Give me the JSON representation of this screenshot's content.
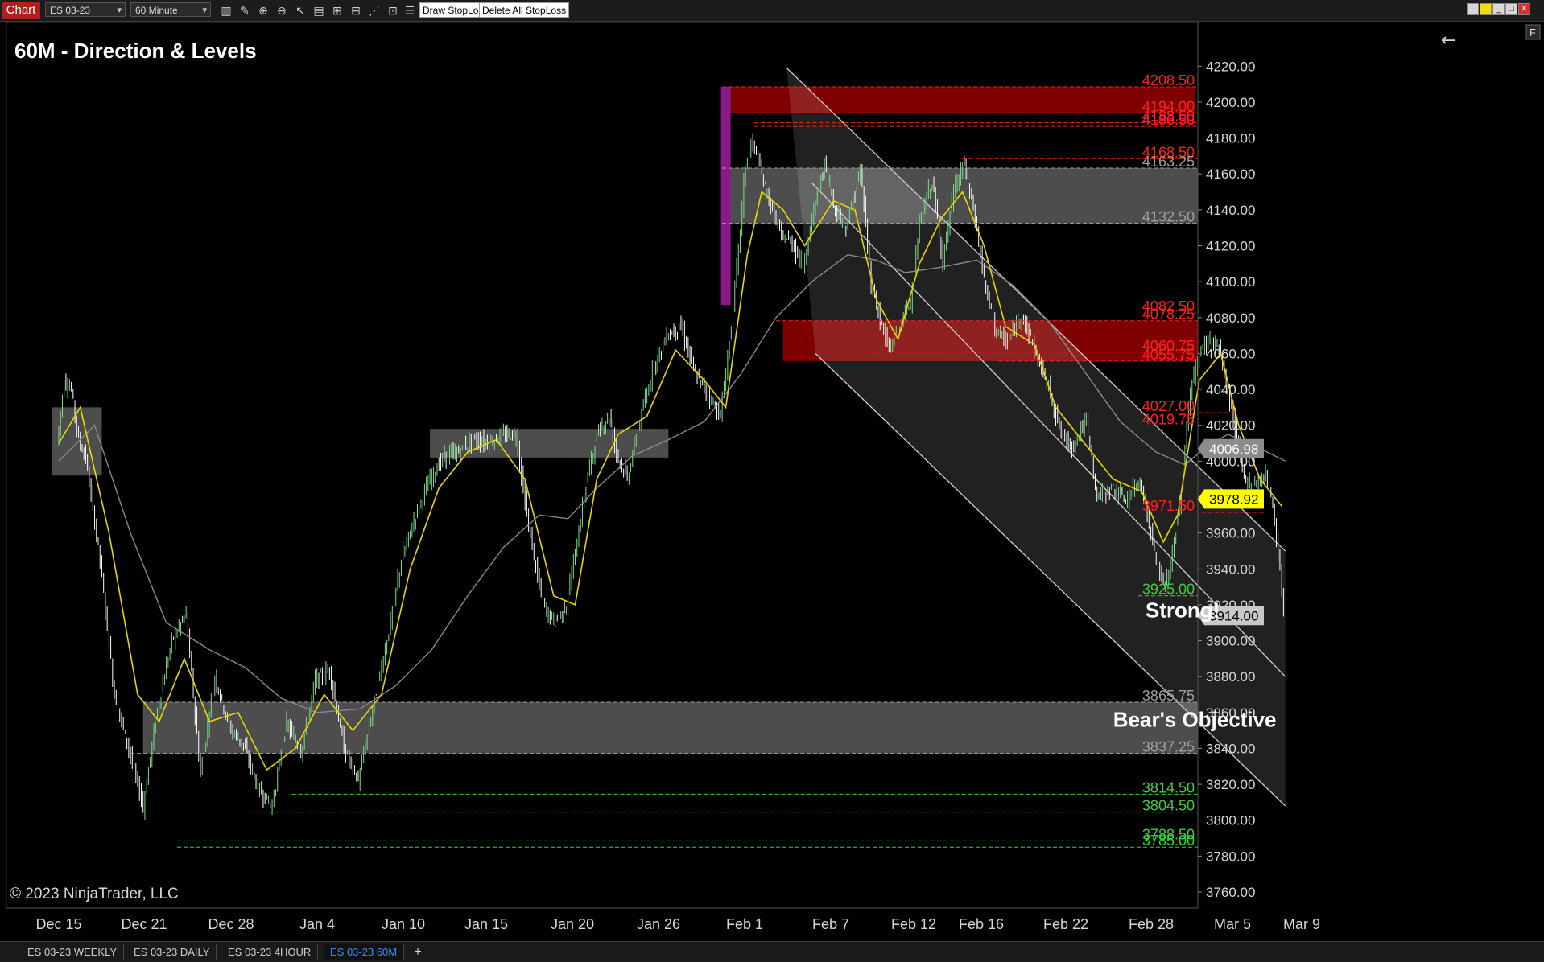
{
  "toolbar": {
    "chart_label": "Chart",
    "instrument": "ES 03-23",
    "interval": "60 Minute",
    "draw_stoploss": "Draw StopLoss",
    "delete_stoploss": "Delete All StopLoss"
  },
  "tabs": [
    {
      "label": "ES 03-23 WEEKLY",
      "active": false
    },
    {
      "label": "ES 03-23 DAILY",
      "active": false
    },
    {
      "label": "ES 03-23 4HOUR",
      "active": false
    },
    {
      "label": "ES 03-23 60M",
      "active": true
    }
  ],
  "tab_add": "+",
  "f_label": "F",
  "chart_data": {
    "type": "candlestick",
    "title": "60M - Direction & Levels",
    "copyright": "© 2023 NinjaTrader, LLC",
    "ylim": [
      3760,
      4230
    ],
    "y_ticks": [
      "4220.00",
      "4200.00",
      "4180.00",
      "4160.00",
      "4140.00",
      "4120.00",
      "4100.00",
      "4080.00",
      "4060.00",
      "4040.00",
      "4020.00",
      "4000.00",
      "3980.00",
      "3960.00",
      "3940.00",
      "3920.00",
      "3900.00",
      "3880.00",
      "3860.00",
      "3840.00",
      "3820.00",
      "3800.00",
      "3780.00",
      "3760.00"
    ],
    "x_ticks": [
      "Dec 15",
      "Dec 21",
      "Dec 28",
      "Jan 4",
      "Jan 10",
      "Jan 15",
      "Jan 20",
      "Jan 26",
      "Feb 1",
      "Feb 7",
      "Feb 12",
      "Feb 16",
      "Feb 22",
      "Feb 28",
      "Mar 5",
      "Mar 9"
    ],
    "price_series": [
      [
        0,
        4010
      ],
      [
        0.2,
        4045
      ],
      [
        0.4,
        4040
      ],
      [
        0.6,
        4012
      ],
      [
        0.8,
        4002
      ],
      [
        1.2,
        3945
      ],
      [
        1.6,
        3870
      ],
      [
        2.0,
        3840
      ],
      [
        2.4,
        3808
      ],
      [
        2.8,
        3862
      ],
      [
        3.2,
        3900
      ],
      [
        3.6,
        3915
      ],
      [
        4.0,
        3825
      ],
      [
        4.4,
        3880
      ],
      [
        4.8,
        3852
      ],
      [
        5.2,
        3842
      ],
      [
        5.6,
        3818
      ],
      [
        6.0,
        3808
      ],
      [
        6.4,
        3854
      ],
      [
        6.8,
        3838
      ],
      [
        7.2,
        3878
      ],
      [
        7.6,
        3884
      ],
      [
        8.0,
        3840
      ],
      [
        8.4,
        3822
      ],
      [
        8.8,
        3862
      ],
      [
        9.2,
        3900
      ],
      [
        9.6,
        3945
      ],
      [
        10.0,
        3970
      ],
      [
        10.4,
        3990
      ],
      [
        10.8,
        4003
      ],
      [
        11.2,
        4005
      ],
      [
        11.6,
        4012
      ],
      [
        12.0,
        4010
      ],
      [
        12.4,
        4014
      ],
      [
        12.8,
        4015
      ],
      [
        13.1,
        3970
      ],
      [
        13.4,
        3935
      ],
      [
        13.6,
        3918
      ],
      [
        13.9,
        3910
      ],
      [
        14.2,
        3920
      ],
      [
        14.5,
        3955
      ],
      [
        14.8,
        3993
      ],
      [
        15.1,
        4017
      ],
      [
        15.4,
        4025
      ],
      [
        15.6,
        4005
      ],
      [
        15.9,
        3990
      ],
      [
        16.2,
        4018
      ],
      [
        16.6,
        4050
      ],
      [
        17.0,
        4070
      ],
      [
        17.4,
        4075
      ],
      [
        17.8,
        4048
      ],
      [
        18.2,
        4036
      ],
      [
        18.5,
        4025
      ],
      [
        18.8,
        4075
      ],
      [
        19.0,
        4118
      ],
      [
        19.2,
        4165
      ],
      [
        19.4,
        4178
      ],
      [
        19.6,
        4163
      ],
      [
        19.9,
        4142
      ],
      [
        20.2,
        4125
      ],
      [
        20.5,
        4122
      ],
      [
        20.8,
        4108
      ],
      [
        21.1,
        4140
      ],
      [
        21.4,
        4166
      ],
      [
        21.7,
        4140
      ],
      [
        22.0,
        4130
      ],
      [
        22.4,
        4162
      ],
      [
        22.7,
        4100
      ],
      [
        23.0,
        4075
      ],
      [
        23.2,
        4062
      ],
      [
        23.5,
        4075
      ],
      [
        23.8,
        4090
      ],
      [
        24.1,
        4138
      ],
      [
        24.4,
        4156
      ],
      [
        24.7,
        4112
      ],
      [
        25.0,
        4150
      ],
      [
        25.3,
        4166
      ],
      [
        25.6,
        4135
      ],
      [
        25.9,
        4095
      ],
      [
        26.2,
        4072
      ],
      [
        26.5,
        4066
      ],
      [
        26.9,
        4082
      ],
      [
        27.3,
        4060
      ],
      [
        27.7,
        4038
      ],
      [
        28.0,
        4015
      ],
      [
        28.3,
        4008
      ],
      [
        28.7,
        4023
      ],
      [
        29.0,
        3980
      ],
      [
        29.4,
        3985
      ],
      [
        29.8,
        3978
      ],
      [
        30.2,
        3990
      ],
      [
        30.5,
        3960
      ],
      [
        30.8,
        3932
      ],
      [
        31.0,
        3936
      ],
      [
        31.3,
        3975
      ],
      [
        31.6,
        4040
      ],
      [
        31.9,
        4062
      ],
      [
        32.1,
        4068
      ],
      [
        32.4,
        4063
      ],
      [
        32.6,
        4044
      ],
      [
        32.8,
        4023
      ],
      [
        33.1,
        3990
      ],
      [
        33.4,
        3987
      ],
      [
        33.7,
        3993
      ],
      [
        33.9,
        3976
      ],
      [
        34.1,
        3940
      ],
      [
        34.2,
        3915
      ]
    ],
    "ema_fast": [
      [
        0,
        4010
      ],
      [
        0.6,
        4030
      ],
      [
        1.4,
        3960
      ],
      [
        2.2,
        3870
      ],
      [
        2.8,
        3855
      ],
      [
        3.5,
        3890
      ],
      [
        4.2,
        3855
      ],
      [
        5.0,
        3860
      ],
      [
        5.8,
        3828
      ],
      [
        6.6,
        3840
      ],
      [
        7.4,
        3870
      ],
      [
        8.2,
        3850
      ],
      [
        9.0,
        3870
      ],
      [
        9.8,
        3940
      ],
      [
        10.6,
        3985
      ],
      [
        11.4,
        4005
      ],
      [
        12.2,
        4012
      ],
      [
        13.0,
        3990
      ],
      [
        13.8,
        3925
      ],
      [
        14.4,
        3920
      ],
      [
        15.0,
        3990
      ],
      [
        15.6,
        4015
      ],
      [
        16.4,
        4025
      ],
      [
        17.2,
        4062
      ],
      [
        18.0,
        4045
      ],
      [
        18.6,
        4030
      ],
      [
        19.2,
        4115
      ],
      [
        19.6,
        4150
      ],
      [
        20.2,
        4140
      ],
      [
        20.8,
        4120
      ],
      [
        21.6,
        4145
      ],
      [
        22.2,
        4140
      ],
      [
        22.8,
        4090
      ],
      [
        23.4,
        4068
      ],
      [
        24.0,
        4110
      ],
      [
        24.6,
        4135
      ],
      [
        25.2,
        4150
      ],
      [
        25.8,
        4120
      ],
      [
        26.4,
        4075
      ],
      [
        27.2,
        4065
      ],
      [
        27.8,
        4030
      ],
      [
        28.6,
        4010
      ],
      [
        29.4,
        3990
      ],
      [
        30.2,
        3983
      ],
      [
        30.8,
        3955
      ],
      [
        31.2,
        3970
      ],
      [
        31.8,
        4045
      ],
      [
        32.4,
        4060
      ],
      [
        32.9,
        4020
      ],
      [
        33.5,
        3990
      ],
      [
        34.1,
        3975
      ]
    ],
    "sma_slow": [
      [
        0,
        4000
      ],
      [
        1.0,
        4020
      ],
      [
        2.0,
        3960
      ],
      [
        3.0,
        3910
      ],
      [
        4.2,
        3895
      ],
      [
        5.2,
        3885
      ],
      [
        6.2,
        3868
      ],
      [
        7.2,
        3860
      ],
      [
        8.4,
        3862
      ],
      [
        9.4,
        3875
      ],
      [
        10.4,
        3895
      ],
      [
        11.4,
        3925
      ],
      [
        12.4,
        3952
      ],
      [
        13.4,
        3970
      ],
      [
        14.2,
        3968
      ],
      [
        15.0,
        3985
      ],
      [
        16.0,
        4003
      ],
      [
        17.0,
        4012
      ],
      [
        18.0,
        4022
      ],
      [
        19.0,
        4048
      ],
      [
        20.0,
        4080
      ],
      [
        21.0,
        4100
      ],
      [
        22.0,
        4115
      ],
      [
        22.8,
        4112
      ],
      [
        23.6,
        4105
      ],
      [
        24.6,
        4108
      ],
      [
        25.6,
        4112
      ],
      [
        26.6,
        4098
      ],
      [
        27.6,
        4078
      ],
      [
        28.6,
        4050
      ],
      [
        29.6,
        4022
      ],
      [
        30.6,
        4005
      ],
      [
        31.4,
        3998
      ],
      [
        32.0,
        4008
      ],
      [
        32.6,
        4015
      ],
      [
        33.4,
        4008
      ],
      [
        34.2,
        4000
      ]
    ],
    "gray_zones": [
      {
        "y_high": 4163.25,
        "y_low": 4132.5,
        "x_from": 18.5,
        "x_to": 34.2
      },
      {
        "y_high": 4018.0,
        "y_low": 4002.0,
        "x_from": 10.35,
        "x_to": 17.0
      },
      {
        "y_high": 4030.0,
        "y_low": 3992.0,
        "x_from": -0.2,
        "x_to": 1.2
      },
      {
        "y_high": 3865.75,
        "y_low": 3837.25,
        "x_from": 2.35,
        "x_to": 34.2
      }
    ],
    "red_zones": [
      {
        "y_high": 4208.5,
        "y_low": 4194.0,
        "x_from": 18.7,
        "x_to": 31.7
      },
      {
        "y_high": 4078.25,
        "y_low": 4055.75,
        "x_from": 20.2,
        "x_to": 34.2
      }
    ],
    "purple_bar": {
      "x": 18.6,
      "y_high": 4208.5,
      "y_low": 4087
    },
    "channel": {
      "upper": [
        [
          20.3,
          4219
        ],
        [
          34.2,
          3950
        ]
      ],
      "middle": [
        [
          21.0,
          4155
        ],
        [
          34.2,
          3880
        ]
      ],
      "lower": [
        [
          21.1,
          4060
        ],
        [
          34.2,
          3808
        ]
      ]
    },
    "levels": [
      {
        "label": "4208.50",
        "value": 4208.5,
        "color": "#ff2020",
        "x_from": 18.5
      },
      {
        "label": "4194.00",
        "value": 4194.0,
        "color": "#ff2020",
        "x_from": 18.6
      },
      {
        "label": "4188.50",
        "value": 4188.5,
        "color": "#ff2020",
        "x_from": 19.4
      },
      {
        "label": "4186.50",
        "value": 4186.5,
        "color": "#ff2020",
        "x_from": 19.4
      },
      {
        "label": "4168.50",
        "value": 4168.5,
        "color": "#ff2020",
        "x_from": 25.2
      },
      {
        "label": "4163.25",
        "value": 4163.25,
        "color": "#a0a0a0",
        "x_from": 18.5
      },
      {
        "label": "4132.50",
        "value": 4132.5,
        "color": "#a0a0a0",
        "x_from": 18.5
      },
      {
        "label": "4082.50",
        "value": 4082.5,
        "color": "#ff2020",
        "x_from": 31.6
      },
      {
        "label": "4078.25",
        "value": 4078.25,
        "color": "#ff2020",
        "x_from": 20.0
      },
      {
        "label": "4060.75",
        "value": 4060.75,
        "color": "#ff2020",
        "x_from": 22.6
      },
      {
        "label": "4055.75",
        "value": 4055.75,
        "color": "#ff2020",
        "x_from": 26.2
      },
      {
        "label": "4027.00",
        "value": 4027.0,
        "color": "#ff2020",
        "x_from": 32.8
      },
      {
        "label": "4019.75",
        "value": 4019.75,
        "color": "#ff2020",
        "x_from": 33.4
      },
      {
        "label": "3971.50",
        "value": 3971.5,
        "color": "#ff2020",
        "x_from": 33.6
      },
      {
        "label": "3925.00",
        "value": 3925.0,
        "color": "#3fcf3f",
        "x_from": 30.1
      },
      {
        "label": "3865.75",
        "value": 3865.75,
        "color": "#a0a0a0",
        "x_from": 2.35
      },
      {
        "label": "3837.25",
        "value": 3837.25,
        "color": "#a0a0a0",
        "x_from": 2.0
      },
      {
        "label": "3814.50",
        "value": 3814.5,
        "color": "#3fcf3f",
        "x_from": 6.5
      },
      {
        "label": "3804.50",
        "value": 3804.5,
        "color": "#3fcf3f",
        "x_from": 5.3
      },
      {
        "label": "3788.50",
        "value": 3788.5,
        "color": "#3fcf3f",
        "x_from": 3.3
      },
      {
        "label": "3785.00",
        "value": 3785.0,
        "color": "#3fcf3f",
        "x_from": 3.3
      }
    ],
    "price_tags": [
      {
        "label": "4006.98",
        "value": 4006.98,
        "bg": "#8c8c8c",
        "fg": "#ffffff"
      },
      {
        "label": "3978.92",
        "value": 3978.92,
        "bg": "#ffff00",
        "fg": "#000000"
      },
      {
        "label": "3914.00",
        "value": 3914.0,
        "bg": "#c8c8c8",
        "fg": "#000000"
      }
    ],
    "annotations": [
      {
        "text": "Strong!",
        "x": 30.3,
        "y": 3913
      },
      {
        "text": "Bear's Objective",
        "x": 29.4,
        "y": 3852
      }
    ],
    "colors": {
      "background": "#000000",
      "bull_candle": "#7fe08a",
      "bear_candle": "#ffffff",
      "ema_fast": "#e8d800",
      "sma_slow": "#8a8a8a",
      "red_zone": "#8a0000",
      "gray_zone": "#5a5a5a",
      "purple": "#8a1a8a"
    }
  }
}
